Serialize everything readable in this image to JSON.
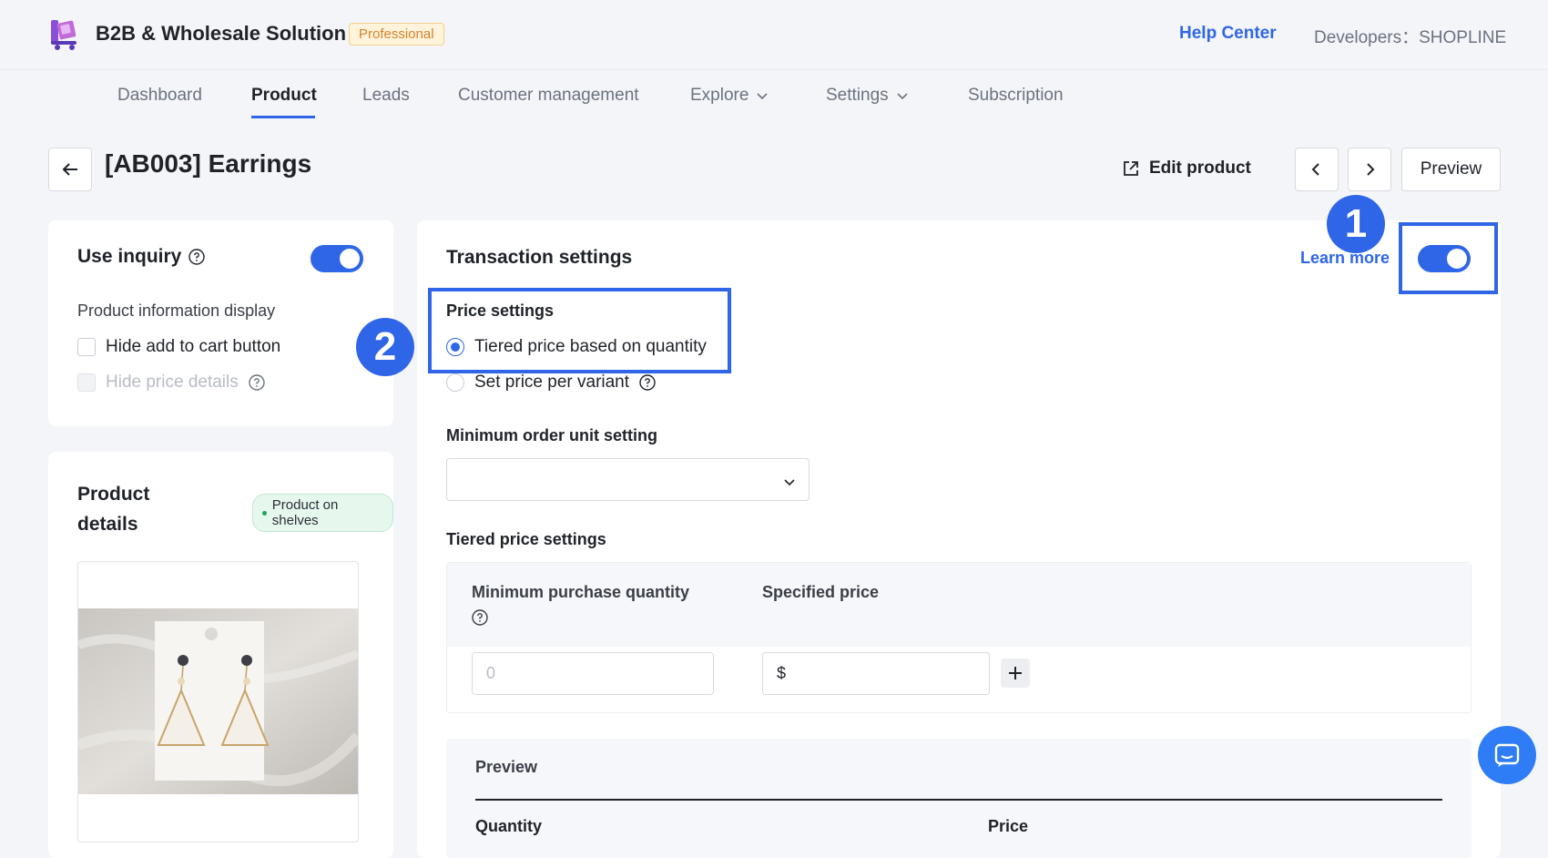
{
  "header": {
    "app_title": "B2B & Wholesale Solution",
    "plan_badge": "Professional",
    "help_center": "Help Center",
    "developers": "Developers：SHOPLINE"
  },
  "nav": {
    "items": [
      {
        "label": "Dashboard"
      },
      {
        "label": "Product"
      },
      {
        "label": "Leads"
      },
      {
        "label": "Customer management"
      },
      {
        "label": "Explore"
      },
      {
        "label": "Settings"
      },
      {
        "label": "Subscription"
      }
    ],
    "active": "Product"
  },
  "page": {
    "title": "[AB003] Earrings",
    "edit_product": "Edit product",
    "preview": "Preview"
  },
  "inquiry": {
    "title": "Use inquiry",
    "enabled": true,
    "info_display_label": "Product information display",
    "hide_add_to_cart": "Hide add to cart button",
    "hide_price_details": "Hide price details"
  },
  "product_details": {
    "title_line1": "Product",
    "title_line2": "details",
    "status": "Product on shelves"
  },
  "transaction": {
    "title": "Transaction settings",
    "learn_more": "Learn more",
    "enabled": true,
    "price_settings_label": "Price settings",
    "option_tiered": "Tiered price based on quantity",
    "option_variant": "Set price per variant",
    "selected_option": "Tiered price based on quantity",
    "min_order_unit_label": "Minimum order unit setting",
    "min_order_unit_value": "",
    "tiered_label": "Tiered price settings",
    "col_min_qty": "Minimum purchase quantity",
    "col_price": "Specified price",
    "qty_placeholder": "0",
    "price_prefix": "$",
    "preview_label": "Preview",
    "preview_col_qty": "Quantity",
    "preview_col_price": "Price"
  },
  "annotations": {
    "step1": "1",
    "step2": "2"
  },
  "colors": {
    "accent": "#2f66e8",
    "badge_bg": "#fff3dc",
    "status_green": "#22a45d"
  }
}
